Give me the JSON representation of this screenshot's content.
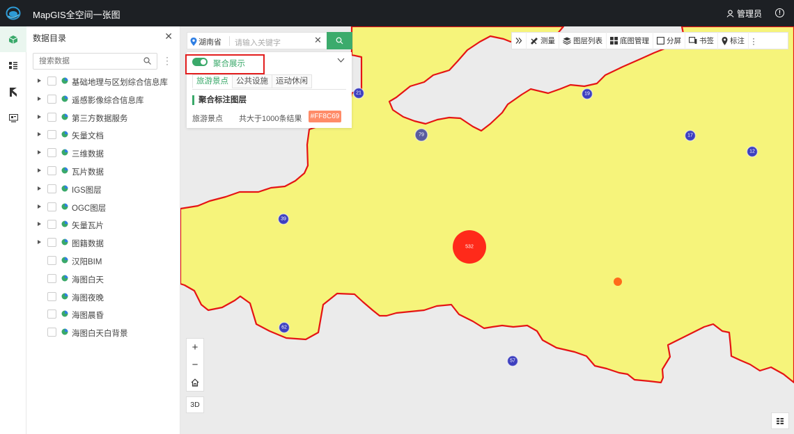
{
  "header": {
    "title": "MapGIS全空间一张图",
    "user": "管理员"
  },
  "catalog": {
    "title": "数据目录",
    "search_placeholder": "搜索数据",
    "items": [
      {
        "label": "基础地理与区划综合信息库",
        "expandable": true
      },
      {
        "label": "遥感影像综合信息库",
        "expandable": true
      },
      {
        "label": "第三方数据服务",
        "expandable": true
      },
      {
        "label": "矢量文档",
        "expandable": true
      },
      {
        "label": "三维数据",
        "expandable": true
      },
      {
        "label": "瓦片数据",
        "expandable": true
      },
      {
        "label": "IGS图层",
        "expandable": true
      },
      {
        "label": "OGC图层",
        "expandable": true
      },
      {
        "label": "矢量瓦片",
        "expandable": true
      },
      {
        "label": "图籍数据",
        "expandable": true
      },
      {
        "label": "汉阳BIM",
        "expandable": false
      },
      {
        "label": "海图白天",
        "expandable": false
      },
      {
        "label": "海图夜晚",
        "expandable": false
      },
      {
        "label": "海图晨昏",
        "expandable": false
      },
      {
        "label": "海图白天白背景",
        "expandable": false
      }
    ]
  },
  "map_search": {
    "region": "湖南省",
    "placeholder": "请输入关键字"
  },
  "cluster_panel": {
    "toggle_label": "聚合展示",
    "tabs": [
      "旅游景点",
      "公共设施",
      "运动休闲"
    ],
    "active_tab": 0,
    "layer_title": "聚合标注图层",
    "row_name": "旅游景点",
    "row_count": "共大于1000条结果",
    "color_tag": "#FF8C69"
  },
  "toolbar": {
    "items": [
      {
        "label": "",
        "icon": "double-chevron-right-icon"
      },
      {
        "label": "测量",
        "icon": "ruler-icon"
      },
      {
        "label": "图层列表",
        "icon": "layers-icon"
      },
      {
        "label": "底图管理",
        "icon": "grid-icon"
      },
      {
        "label": "分屏",
        "icon": "split-screen-icon"
      },
      {
        "label": "书签",
        "icon": "bookmark-icon"
      },
      {
        "label": "标注",
        "icon": "pin-icon"
      },
      {
        "label": "",
        "icon": "more-icon"
      }
    ]
  },
  "map_controls": {
    "zoom_in": "+",
    "zoom_out": "−",
    "mode_3d": "3D"
  },
  "clusters": [
    {
      "label": "21",
      "kind": "small"
    },
    {
      "label": "19",
      "kind": "small"
    },
    {
      "label": "79",
      "kind": "medium"
    },
    {
      "label": "17",
      "kind": "small"
    },
    {
      "label": "12",
      "kind": "small"
    },
    {
      "label": "39",
      "kind": "small"
    },
    {
      "label": "532",
      "kind": "large"
    },
    {
      "label": "",
      "kind": "single"
    },
    {
      "label": "62",
      "kind": "small"
    },
    {
      "label": "57",
      "kind": "small"
    }
  ],
  "colors": {
    "accent": "#3aa96a",
    "region_fill": "#f6f47b",
    "region_border": "#e51414",
    "cluster_small": "#3d3fbf",
    "cluster_large": "#ff2a1a",
    "single_point": "#ff6a1a",
    "highlight_box": "#e21d1d"
  }
}
